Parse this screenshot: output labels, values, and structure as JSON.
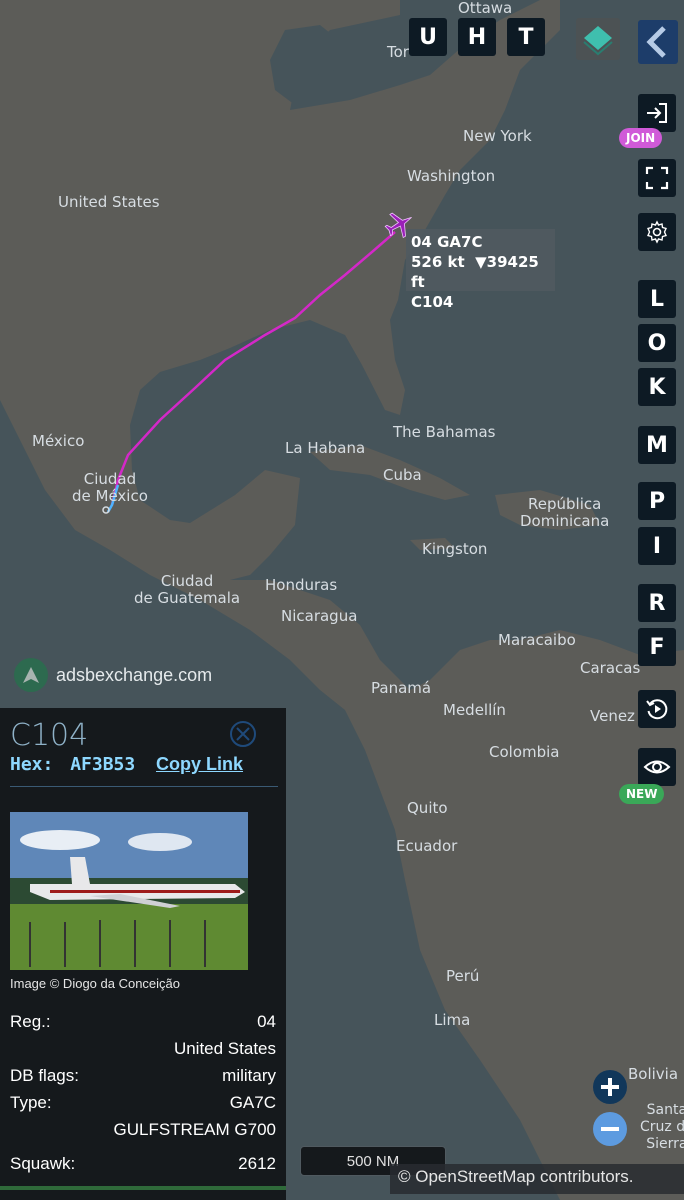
{
  "top_buttons": [
    "U",
    "H",
    "T"
  ],
  "side_letters": [
    "L",
    "O",
    "K",
    "M",
    "P",
    "I",
    "R",
    "F"
  ],
  "badges": {
    "join": "JOIN",
    "new": "NEW"
  },
  "map_labels": {
    "ottawa": "Ottawa",
    "toronto": "Tor",
    "new_york": "New York",
    "washington": "Washington",
    "united_states": "United States",
    "mexico": "México",
    "ciudad_mexico": "Ciudad\nde México",
    "la_habana": "La Habana",
    "bahamas": "The Bahamas",
    "cuba": "Cuba",
    "dominicana": "República\nDominicana",
    "kingston": "Kingston",
    "guatemala": "Ciudad\nde Guatemala",
    "honduras": "Honduras",
    "nicaragua": "Nicaragua",
    "maracaibo": "Maracaibo",
    "caracas": "Caracas",
    "venezuela": "Venez",
    "panama": "Panamá",
    "medellin": "Medellín",
    "colombia": "Colombia",
    "quito": "Quito",
    "ecuador": "Ecuador",
    "peru": "Perú",
    "lima": "Lima",
    "bolivia": "Bolivia",
    "santa_cruz": "Santa\nCruz de\nSierra"
  },
  "branding": "adsbexchange.com",
  "aircraft_label": {
    "line1": "04 GA7C",
    "speed": "526 kt",
    "altitude": "▼39425 ft",
    "callsign": "C104"
  },
  "panel": {
    "callsign": "C104",
    "hex_label": "Hex:",
    "hex_value": "AF3B53",
    "copy_link": "Copy Link",
    "image_credit": "Image © Diogo da Conceição",
    "reg_label": "Reg.:",
    "reg_value": "04",
    "country": "United States",
    "db_flags_label": "DB flags:",
    "db_flags_value": "military",
    "type_label": "Type:",
    "type_value": "GA7C",
    "type_name": "GULFSTREAM G700",
    "squawk_label": "Squawk:",
    "squawk_value": "2612"
  },
  "scale": "500 NM",
  "attribution": "© OpenStreetMap contributors.",
  "colors": {
    "button_bg": "#0d1a24",
    "join_badge": "#d05ad8",
    "new_badge": "#3aa858",
    "track": "#d428c8",
    "zoom_in": "#11375a",
    "zoom_out": "#5d9be0",
    "link": "#8ed8ff"
  },
  "icons": {
    "layers": "layers-icon",
    "collapse": "chevron-left-icon",
    "login": "login-icon",
    "fullscreen": "fullscreen-icon",
    "settings": "gear-icon",
    "replay": "replay-icon",
    "view": "eye-icon",
    "close": "close-icon"
  }
}
